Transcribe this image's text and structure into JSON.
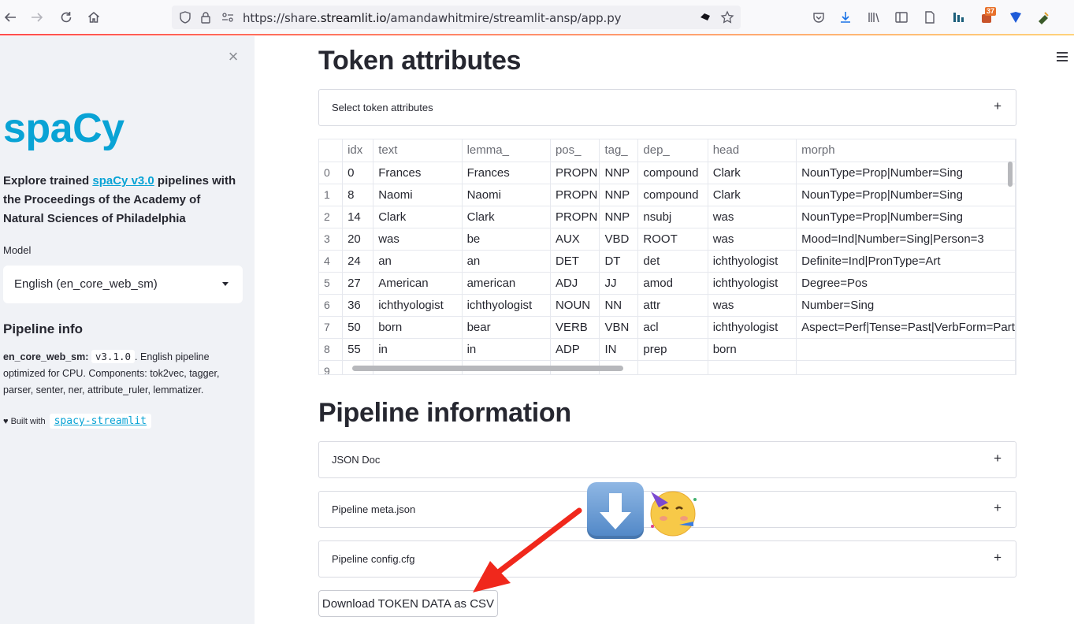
{
  "browser": {
    "url_prefix": "https://share.",
    "url_host": "streamlit.io",
    "url_path": "/amandawhitmire/streamlit-ansp/app.py",
    "extension_badge": "37"
  },
  "sidebar": {
    "close_glyph": "×",
    "brand": "spaCy",
    "intro_prefix": "Explore trained ",
    "intro_link": "spaCy v3.0",
    "intro_suffix": " pipelines with the Proceedings of the Academy of Natural Sciences of Philadelphia",
    "model_label": "Model",
    "model_value": "English (en_core_web_sm)",
    "pipeline_info_title": "Pipeline info",
    "pipeline_name": "en_core_web_sm:",
    "pipeline_version": "v3.1.0",
    "pipeline_desc": ". English pipeline optimized for CPU. Components: tok2vec, tagger, parser, senter, ner, attribute_ruler, lemmatizer.",
    "built_with": "♥ Built with",
    "built_link": "spacy-streamlit"
  },
  "main": {
    "token_title": "Token attributes",
    "select_attrs_label": "Select token attributes",
    "pipeline_title": "Pipeline information",
    "expanders": [
      "JSON Doc",
      "Pipeline meta.json",
      "Pipeline config.cfg"
    ],
    "expander_plus": "+",
    "download_label": "Download TOKEN DATA as CSV"
  },
  "table": {
    "columns": [
      "idx",
      "text",
      "lemma_",
      "pos_",
      "tag_",
      "dep_",
      "head",
      "morph"
    ],
    "rows": [
      [
        "0",
        "0",
        "Frances",
        "Frances",
        "PROPN",
        "NNP",
        "compound",
        "Clark",
        "NounType=Prop|Number=Sing"
      ],
      [
        "1",
        "8",
        "Naomi",
        "Naomi",
        "PROPN",
        "NNP",
        "compound",
        "Clark",
        "NounType=Prop|Number=Sing"
      ],
      [
        "2",
        "14",
        "Clark",
        "Clark",
        "PROPN",
        "NNP",
        "nsubj",
        "was",
        "NounType=Prop|Number=Sing"
      ],
      [
        "3",
        "20",
        "was",
        "be",
        "AUX",
        "VBD",
        "ROOT",
        "was",
        "Mood=Ind|Number=Sing|Person=3"
      ],
      [
        "4",
        "24",
        "an",
        "an",
        "DET",
        "DT",
        "det",
        "ichthyologist",
        "Definite=Ind|PronType=Art"
      ],
      [
        "5",
        "27",
        "American",
        "american",
        "ADJ",
        "JJ",
        "amod",
        "ichthyologist",
        "Degree=Pos"
      ],
      [
        "6",
        "36",
        "ichthyologist",
        "ichthyologist",
        "NOUN",
        "NN",
        "attr",
        "was",
        "Number=Sing"
      ],
      [
        "7",
        "50",
        "born",
        "bear",
        "VERB",
        "VBN",
        "acl",
        "ichthyologist",
        "Aspect=Perf|Tense=Past|VerbForm=Part"
      ],
      [
        "8",
        "55",
        "in",
        "in",
        "ADP",
        "IN",
        "prep",
        "born",
        ""
      ],
      [
        "9",
        "",
        "",
        "",
        "",
        "",
        "",
        "",
        ""
      ]
    ]
  }
}
